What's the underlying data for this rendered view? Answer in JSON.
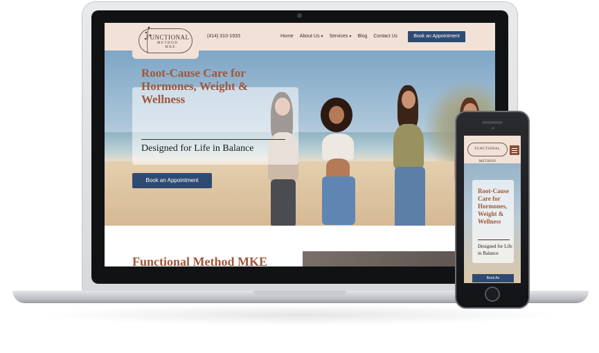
{
  "header": {
    "logo_title": "FUNCTIONAL",
    "logo_sub_1": "METHOD",
    "logo_sub_2": "MKE",
    "phone": "(414) 310-1933",
    "nav": [
      "Home",
      "About Us",
      "Services",
      "Blog",
      "Contact Us"
    ],
    "nav_chevron": "chevron-down-icon",
    "cta": "Book an Appointment"
  },
  "hero": {
    "title": "Root-Cause Care for Hormones, Weight & Wellness",
    "subtitle": "Designed for Life in Balance",
    "cta": "Book an Appointment"
  },
  "section": {
    "title": "Functional Method MKE"
  },
  "mobile": {
    "logo": "FUNCTIONAL METHOD",
    "title": "Root-Cause Care for Hormones, Weight & Wellness",
    "subtitle": "Designed for Life in Balance",
    "cta": "Book An"
  },
  "colors": {
    "accent_brown": "#a0573a",
    "header_bg": "#f2e1d6",
    "cta_blue": "#2e4a73",
    "menu_button": "#8a4f34"
  }
}
